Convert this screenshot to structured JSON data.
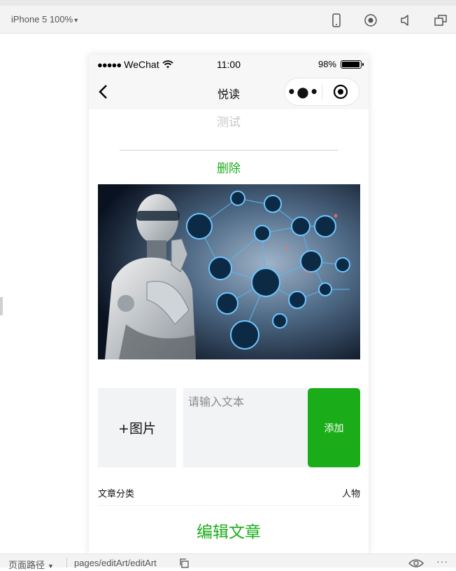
{
  "devtools": {
    "device": "iPhone 5 100%",
    "path_label": "页面路径",
    "path_value": "pages/editArt/editArt",
    "icons": [
      "phone-icon",
      "record-icon",
      "speaker-icon",
      "window-icon",
      "copy-icon",
      "eye-icon",
      "more-icon"
    ]
  },
  "statusbar": {
    "carrier": "WeChat",
    "signal_dots": "●●●●●",
    "time": "11:00",
    "battery_text": "98%",
    "battery_level": 0.98
  },
  "navbar": {
    "title": "悦读",
    "capsule_more": "•●•"
  },
  "content": {
    "prev_text": "测试",
    "delete_label": "删除",
    "add_image_label": "+图片",
    "text_placeholder": "请输入文本",
    "text_value": "",
    "add_button_label": "添加",
    "category_label": "文章分类",
    "category_value": "人物",
    "edit_article_label": "编辑文章"
  },
  "colors": {
    "accent_green": "#1aad19",
    "input_bg": "#f2f3f5",
    "placeholder_gray": "#c8c8c8"
  }
}
